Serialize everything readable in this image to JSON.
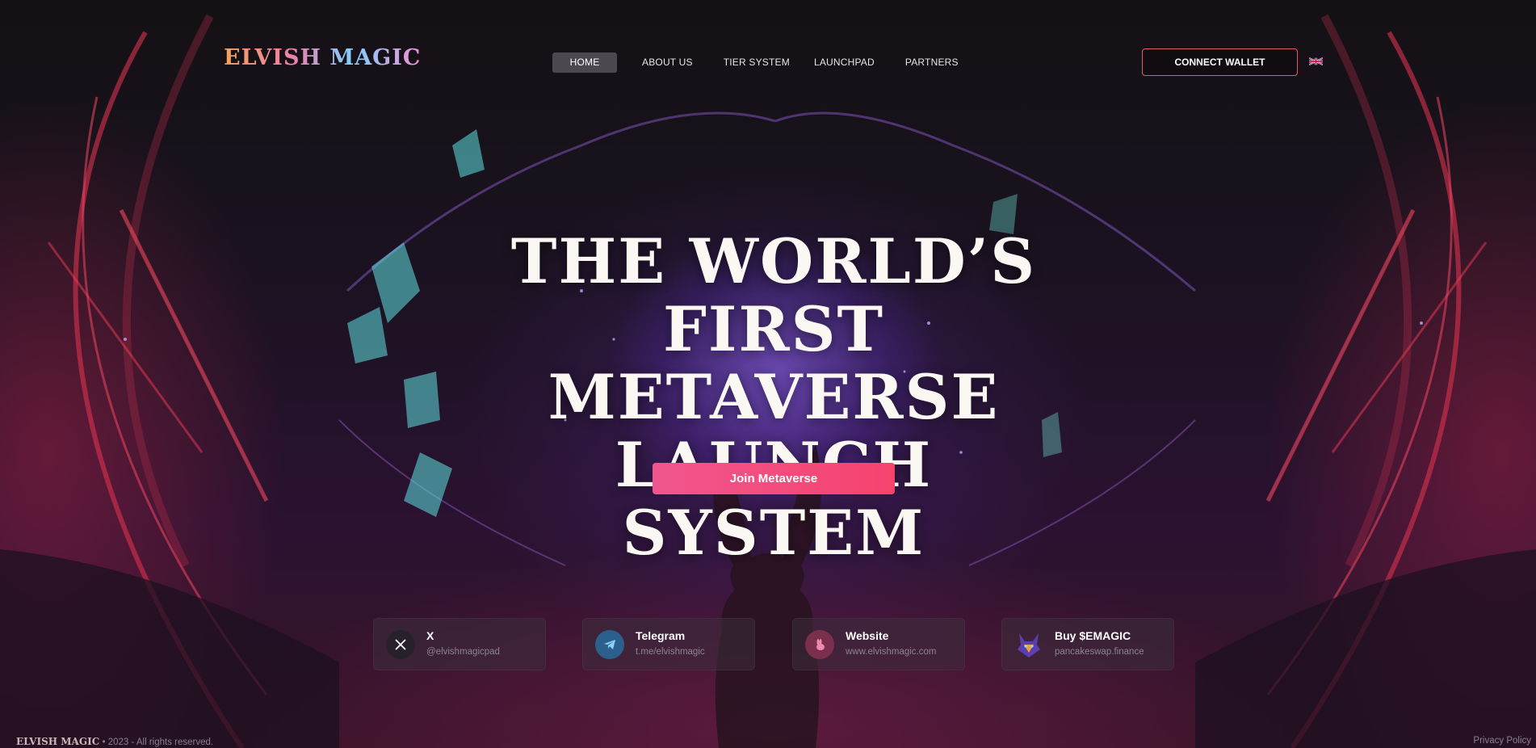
{
  "brand": {
    "logo": "ELVISH MAGIC",
    "footer_logo": "ELVISH MAGIC"
  },
  "nav": {
    "items": [
      {
        "label": "HOME",
        "active": true
      },
      {
        "label": "ABOUT US"
      },
      {
        "label": "TIER SYSTEM"
      },
      {
        "label": "LAUNCHPAD"
      },
      {
        "label": "PARTNERS"
      }
    ]
  },
  "header": {
    "connect_wallet": "CONNECT WALLET",
    "language_icon": "uk-flag-icon"
  },
  "hero": {
    "line1": "THE WORLD’S FIRST",
    "line2": "METAVERSE LAUNCH",
    "line3": "SYSTEM",
    "cta": "Join Metaverse"
  },
  "links": [
    {
      "title": "X",
      "subtitle": "@elvishmagicpad",
      "icon": "x-icon"
    },
    {
      "title": "Telegram",
      "subtitle": "t.me/elvishmagic",
      "icon": "telegram-icon"
    },
    {
      "title": "Website",
      "subtitle": "www.elvishmagic.com",
      "icon": "rabbit-icon"
    },
    {
      "title": "Buy $EMAGIC",
      "subtitle": "pancakeswap.finance",
      "icon": "emagic-token-icon"
    }
  ],
  "footer": {
    "copyright": "• 2023 - All rights reserved.",
    "privacy": "Privacy Policy"
  },
  "colors": {
    "accent": "#f04f7c",
    "wallet_border": "#e25a6a",
    "background": "#161216"
  }
}
